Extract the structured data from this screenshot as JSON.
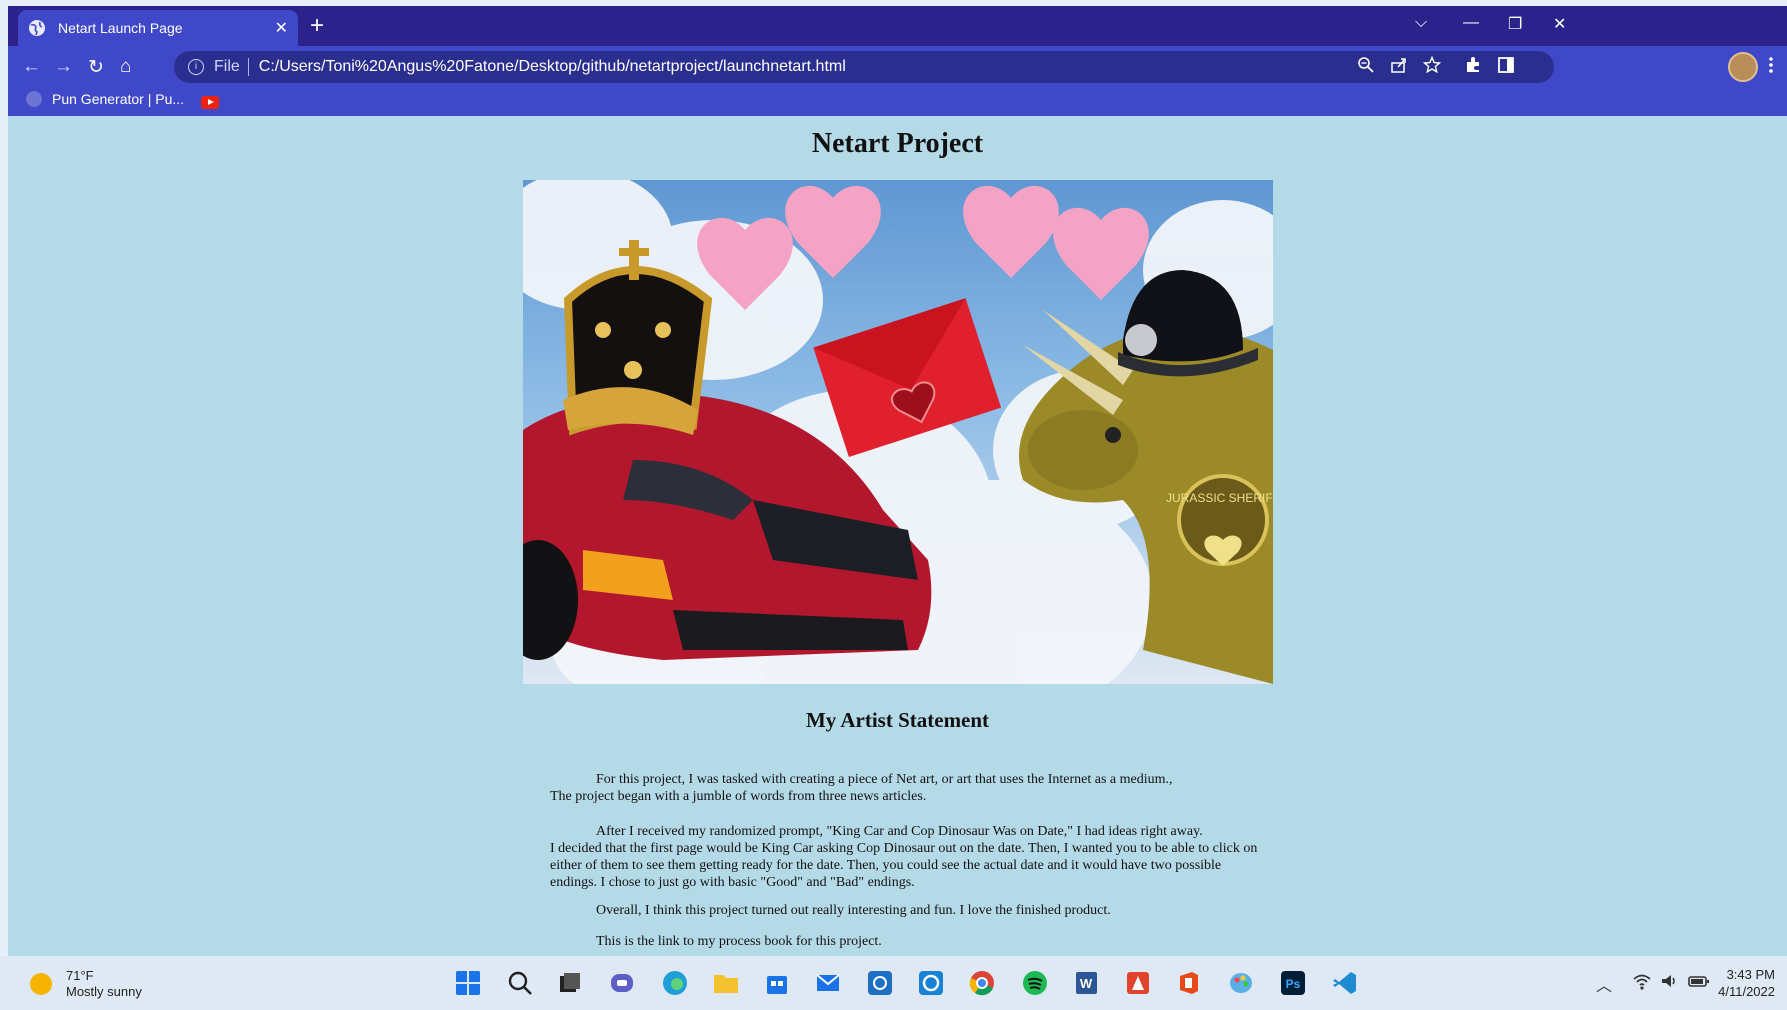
{
  "browser": {
    "tab_title": "Netart Launch Page",
    "tab_close": "✕",
    "new_tab": "+",
    "window_controls": {
      "dropdown": "⌵",
      "minimize": "—",
      "restore": "❐",
      "close": "✕"
    },
    "nav": {
      "back": "←",
      "forward": "→",
      "reload": "↻",
      "home": "⌂"
    },
    "address": {
      "scheme_label": "File",
      "url": "C:/Users/Toni%20Angus%20Fatone/Desktop/github/netartproject/launchnetart.html"
    },
    "bookmarks": [
      {
        "label": "Pun Generator | Pu..."
      }
    ],
    "colors": {
      "titlebar": "#2b228c",
      "toolbar": "#3f48c8",
      "omnibox": "#2a2f8f"
    }
  },
  "page": {
    "title": "Netart Project",
    "statement_heading": "My Artist Statement",
    "paragraphs": [
      {
        "first": "For this project, I was tasked with creating a piece of Net art, or art that uses the Internet as a medium.,",
        "rest": "The project began with a jumble of words from three news articles."
      },
      {
        "first": "After I received my randomized prompt, \"King Car and Cop Dinosaur Was on Date,\" I had ideas right away.",
        "rest": "I decided that the first page would be King Car asking Cop Dinosaur out on the date. Then, I wanted you to be able to click on either of them to see them getting ready for the date. Then, you could see the actual date and it would have two possible endings. I chose to just go with basic \"Good\" and \"Bad\" endings."
      },
      {
        "first": "Overall, I think this project turned out really interesting and fun. I love the finished product.",
        "rest": ""
      },
      {
        "first": "This is the link to my process book for this project.",
        "rest": ""
      }
    ],
    "artwork_badge": "JURASSIC SHERIFF",
    "background": "#b4dae8"
  },
  "taskbar": {
    "weather_temp": "71°F",
    "weather_desc": "Mostly sunny",
    "time": "3:43 PM",
    "date": "4/11/2022"
  }
}
